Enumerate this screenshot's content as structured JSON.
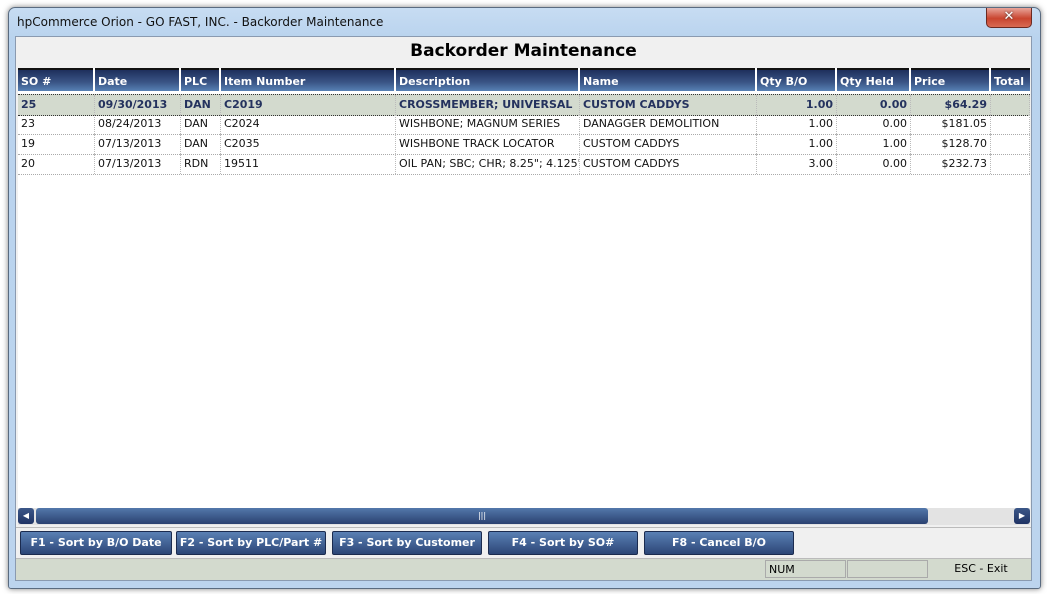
{
  "window": {
    "title": "hpCommerce Orion - GO FAST, INC. - Backorder Maintenance",
    "close_icon": "close-x"
  },
  "page_title": "Backorder Maintenance",
  "columns": [
    "SO #",
    "Date",
    "PLC",
    "Item Number",
    "Description",
    "Name",
    "Qty B/O",
    "Qty Held",
    "Price",
    "Total"
  ],
  "rows": [
    {
      "so": "25",
      "date": "09/30/2013",
      "plc": "DAN",
      "item": "C2019",
      "desc": "CROSSMEMBER; UNIVERSAL",
      "name": "CUSTOM CADDYS",
      "qty_bo": "1.00",
      "qty_held": "0.00",
      "price": "$64.29",
      "total": "",
      "selected": true
    },
    {
      "so": "23",
      "date": "08/24/2013",
      "plc": "DAN",
      "item": "C2024",
      "desc": "WISHBONE; MAGNUM SERIES",
      "name": "DANAGGER DEMOLITION",
      "qty_bo": "1.00",
      "qty_held": "0.00",
      "price": "$181.05",
      "total": ""
    },
    {
      "so": "19",
      "date": "07/13/2013",
      "plc": "DAN",
      "item": "C2035",
      "desc": "WISHBONE TRACK LOCATOR",
      "name": "CUSTOM CADDYS",
      "qty_bo": "1.00",
      "qty_held": "1.00",
      "price": "$128.70",
      "total": ""
    },
    {
      "so": "20",
      "date": "07/13/2013",
      "plc": "RDN",
      "item": "19511",
      "desc": "OIL PAN; SBC; CHR; 8.25\"; 4.125\"...",
      "name": "CUSTOM CADDYS",
      "qty_bo": "3.00",
      "qty_held": "0.00",
      "price": "$232.73",
      "total": ""
    }
  ],
  "buttons": [
    "F1 - Sort by B/O Date",
    "F2 - Sort by PLC/Part #",
    "F3 - Sort by Customer",
    "F4 - Sort by SO#",
    "F8 - Cancel B/O"
  ],
  "status": {
    "num": "NUM",
    "extra": "",
    "exit": "ESC - Exit"
  },
  "colors": {
    "header": "#3b5687",
    "selected_row": "#d3dace",
    "close": "#c9452f"
  }
}
